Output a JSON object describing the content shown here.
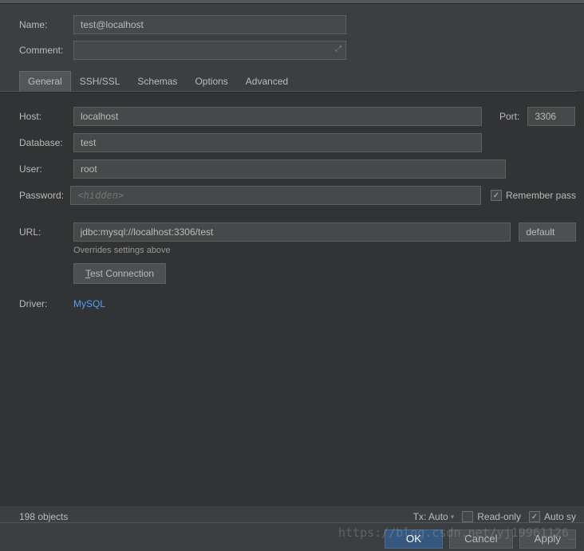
{
  "top": {
    "name_label": "Name:",
    "name_value": "test@localhost",
    "comment_label": "Comment:",
    "comment_value": ""
  },
  "tabs": {
    "general": "General",
    "sshssl": "SSH/SSL",
    "schemas": "Schemas",
    "options": "Options",
    "advanced": "Advanced"
  },
  "general": {
    "host_label": "Host:",
    "host_value": "localhost",
    "port_label": "Port:",
    "port_value": "3306",
    "database_label": "Database:",
    "database_value": "test",
    "user_label": "User:",
    "user_value": "root",
    "password_label": "Password:",
    "password_placeholder": "<hidden>",
    "remember_label": "Remember pass",
    "url_label": "URL:",
    "url_value": "jdbc:mysql://localhost:3306/test",
    "url_mode": "default",
    "url_hint": "Overrides settings above",
    "test_btn_prefix": "T",
    "test_btn_rest": "est Connection",
    "driver_label": "Driver:",
    "driver_link": "MySQL"
  },
  "footer": {
    "objects": "198 objects",
    "tx": "Tx: Auto",
    "readonly": "Read-only",
    "autosync": "Auto sy"
  },
  "buttons": {
    "ok": "OK",
    "cancel": "Cancel",
    "apply": "Apply"
  },
  "watermark": "https://blog.csdn.net/yj19961126_"
}
